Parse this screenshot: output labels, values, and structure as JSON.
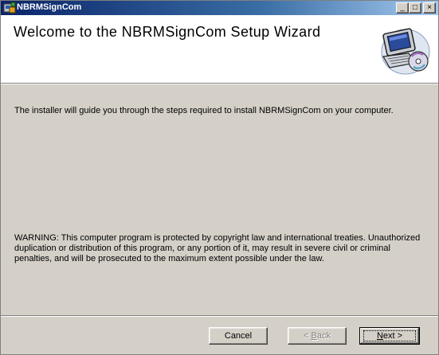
{
  "window": {
    "title": "NBRMSignCom"
  },
  "titlebar_buttons": {
    "minimize": "_",
    "maximize": "□",
    "close": "×"
  },
  "header": {
    "title": "Welcome to the NBRMSignCom Setup Wizard",
    "art_icon": "computer-disc-icon"
  },
  "content": {
    "intro": "The installer will guide you through the steps required to install NBRMSignCom on your computer.",
    "warning": "WARNING: This computer program is protected by copyright law and international treaties. Unauthorized duplication or distribution of this program, or any portion of it, may result in severe civil or criminal penalties, and will be prosecuted to the maximum extent possible under the law."
  },
  "buttons": {
    "cancel": "Cancel",
    "back_pre": "< ",
    "back_accel": "B",
    "back_post": "ack",
    "next_accel": "N",
    "next_post": "ext >"
  }
}
